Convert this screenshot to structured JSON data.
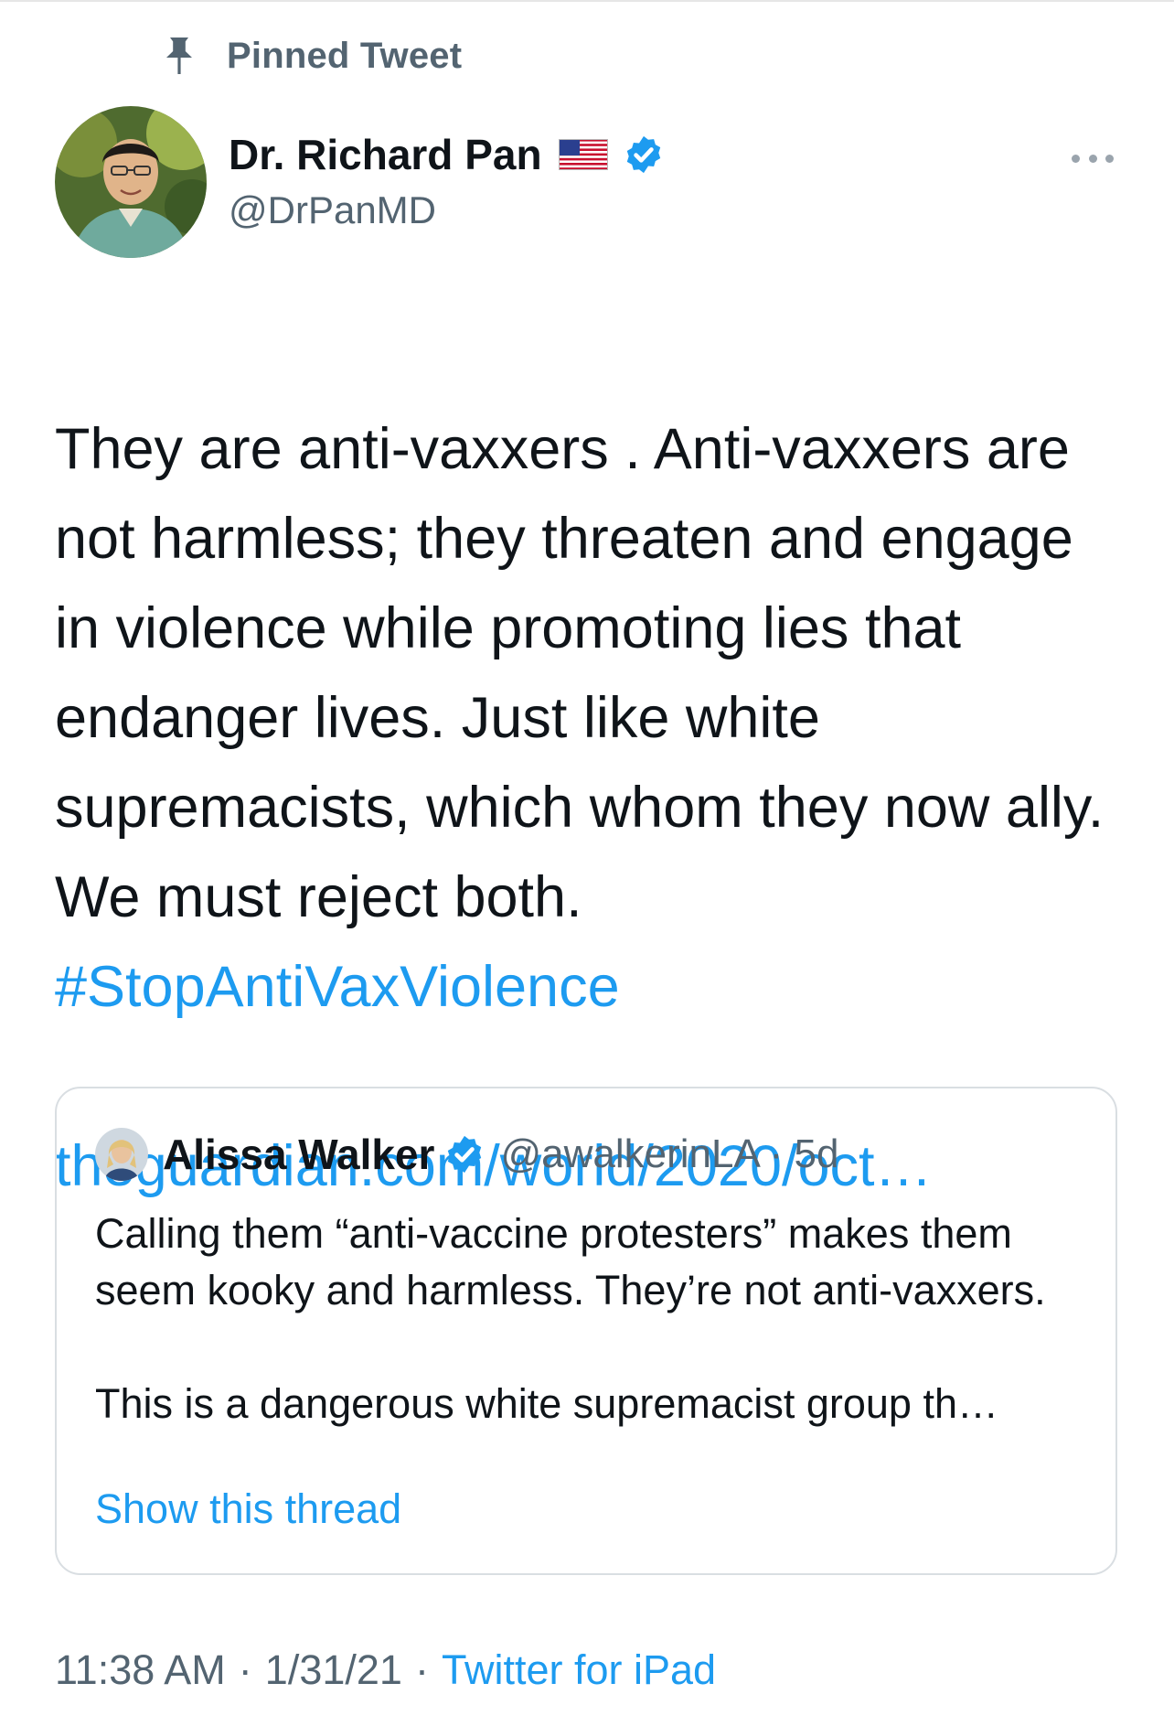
{
  "pinned": {
    "label": "Pinned Tweet"
  },
  "author": {
    "display_name": "Dr. Richard Pan",
    "handle": "@DrPanMD"
  },
  "tweet": {
    "text": "They are anti-vaxxers . Anti-vaxxers are not harmless; they threaten and engage in violence while promoting lies that endanger lives. Just like white supremacists, which whom they now ally. We must reject both.",
    "hashtag": "#StopAntiVaxViolence",
    "link": "theguardian.com/world/2020/oct…"
  },
  "quoted_tweet": {
    "display_name": "Alissa Walker",
    "handle_time": "@awalkerinLA · 5d",
    "paragraph1": "Calling them “anti-vaccine protesters” makes them seem kooky and harmless. They’re not anti-vaxxers.",
    "paragraph2": "This is a dangerous white supremacist group th…",
    "show_thread": "Show this thread"
  },
  "meta": {
    "time": "11:38 AM",
    "date": "1/31/21",
    "source": "Twitter for iPad",
    "separator": "·"
  },
  "colors": {
    "link": "#1d9bf0",
    "secondary_text": "#536471",
    "primary_text": "#0f1419",
    "verified": "#1d9bf0"
  },
  "icons": {
    "pin": "pin-icon",
    "verified": "verified-badge-icon",
    "flag": "us-flag-icon",
    "more": "more-options-icon"
  }
}
